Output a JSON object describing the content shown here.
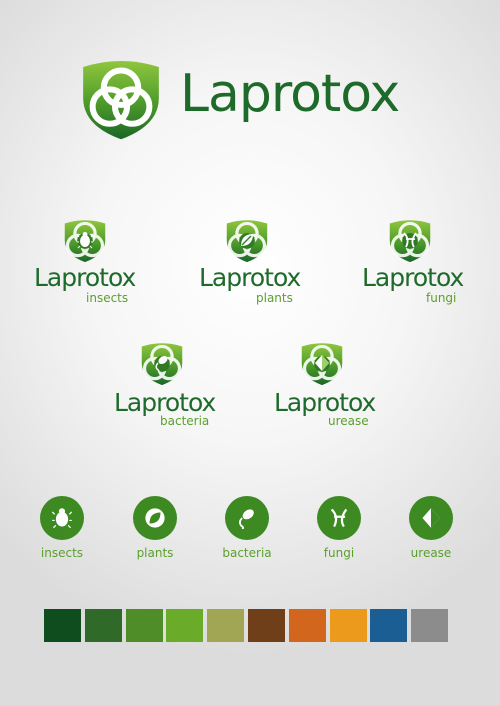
{
  "main_logo": {
    "name": "Laprotox"
  },
  "variants": [
    {
      "name": "Laprotox",
      "sub": "insects"
    },
    {
      "name": "Laprotox",
      "sub": "plants"
    },
    {
      "name": "Laprotox",
      "sub": "fungi"
    },
    {
      "name": "Laprotox",
      "sub": "bacteria"
    },
    {
      "name": "Laprotox",
      "sub": "urease"
    }
  ],
  "icons": [
    {
      "label": "insects",
      "icon": "beetle-icon"
    },
    {
      "label": "plants",
      "icon": "leaf-icon"
    },
    {
      "label": "bacteria",
      "icon": "bacteria-icon"
    },
    {
      "label": "fungi",
      "icon": "fungi-icon"
    },
    {
      "label": "urease",
      "icon": "urease-icon"
    }
  ],
  "palette": [
    "#0f4d1f",
    "#2f6a28",
    "#4f8d28",
    "#6aac2a",
    "#a0a653",
    "#6e3f19",
    "#d2661d",
    "#ec9a1c",
    "#1b5e94",
    "#8c8c8c"
  ]
}
